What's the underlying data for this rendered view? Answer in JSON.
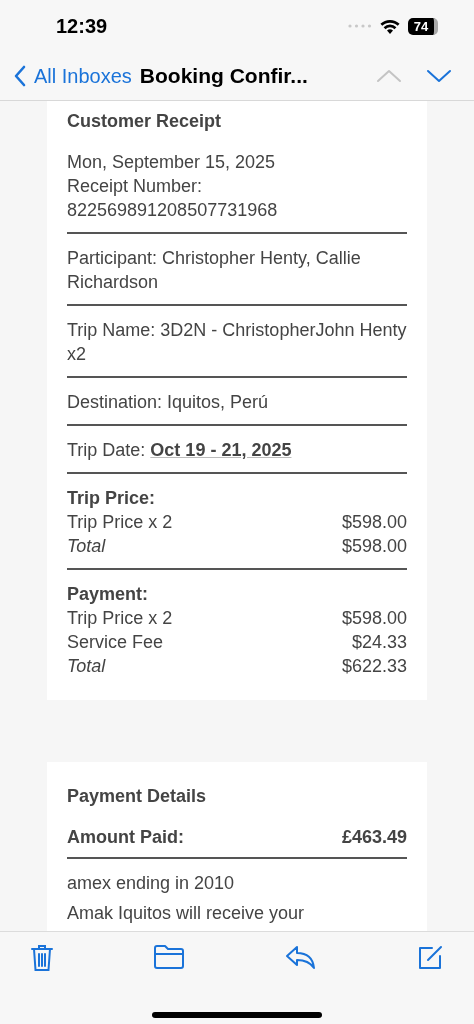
{
  "status_bar": {
    "time": "12:39",
    "battery": "74"
  },
  "nav": {
    "back": "All Inboxes",
    "title": "Booking Confir...",
    "previous_disabled": true,
    "next_disabled": false
  },
  "receipt": {
    "title": "Customer Receipt",
    "sections": [
      {
        "kind": "text",
        "lines": [
          "Mon, September 15, 2025",
          "Receipt Number:",
          "822569891208507731968"
        ]
      },
      {
        "kind": "text",
        "lines": [
          "Participant: Christopher Henty, Callie Richardson"
        ]
      },
      {
        "kind": "text",
        "lines": [
          "Trip Name: 3D2N - ChristopherJohn Henty x2"
        ]
      },
      {
        "kind": "text",
        "lines": [
          "Destination: Iquitos, Perú"
        ]
      },
      {
        "kind": "text",
        "lines": [
          "Trip Date: **Oct 19 - 21, 2025**"
        ]
      },
      {
        "kind": "prices",
        "heading": "Trip Price:",
        "rows": [
          {
            "kind": "item",
            "label": "Trip Price x 2",
            "amount": "$598.00"
          },
          {
            "kind": "total",
            "label": "Total",
            "amount": "$598.00"
          }
        ]
      },
      {
        "kind": "prices",
        "heading": "Payment:",
        "rows": [
          {
            "kind": "item",
            "label": "Trip Price x 2",
            "amount": "$598.00"
          },
          {
            "kind": "item",
            "label": "Service Fee",
            "amount": "$24.33"
          },
          {
            "kind": "total",
            "label": "Total",
            "amount": "$622.33"
          }
        ]
      }
    ]
  },
  "payment_details": {
    "title": "Payment Details",
    "amount_label": "Amount Paid:",
    "amount": "£463.49",
    "card": "amex ending in 2010",
    "note": "Amak Iquitos will receive your"
  }
}
